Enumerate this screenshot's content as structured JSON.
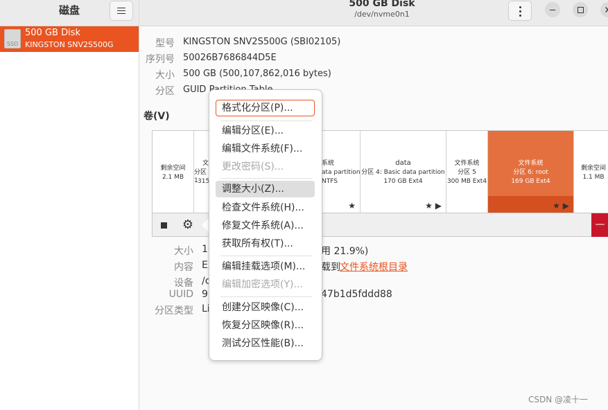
{
  "sidebar": {
    "title": "磁盘",
    "disk": {
      "icon_text": "SSD",
      "name": "500 GB Disk",
      "model": "KINGSTON SNV2S500G"
    }
  },
  "header": {
    "title": "500 GB Disk",
    "subtitle": "/dev/nvme0n1"
  },
  "drive_info": {
    "model_label": "型号",
    "model_value": "KINGSTON SNV2S500G (SBI02105)",
    "serial_label": "序列号",
    "serial_value": "50026B7686844D5E",
    "size_label": "大小",
    "size_value": "500 GB (500,107,862,016 bytes)",
    "partition_label": "分区",
    "partition_value": "GUID Partition Table"
  },
  "volumes": {
    "heading": "卷(V)",
    "segments": [
      {
        "line1": "剩余空间",
        "line2": "2.1 MB",
        "line3": ""
      },
      {
        "line1": "文",
        "line2": "分区 1",
        "line3": "315"
      },
      {
        "line1": "系统",
        "line2": "ata partition",
        "line3": "NTFS"
      },
      {
        "line1": "data",
        "line2": "分区 4:  Basic data partition",
        "line3": "170 GB Ext4"
      },
      {
        "line1": "文件系统",
        "line2": "分区 5",
        "line3": "300 MB Ext4"
      },
      {
        "line1": "文件系统",
        "line2": "分区 6:  root",
        "line3": "169 GB Ext4"
      },
      {
        "line1": "剩余空间",
        "line2": "1.1 MB",
        "line3": ""
      }
    ],
    "star_icon": "★",
    "play_icon": "▶"
  },
  "toolbar": {
    "gear_icon": "⚙",
    "minus_label": "—"
  },
  "details": {
    "size_label": "大小",
    "size_value": "16",
    "size_suffix": "用 21.9%)",
    "contents_label": "内容",
    "contents_value": "Ex",
    "contents_suffix": "载到",
    "contents_link": "文件系统根目录",
    "device_label": "设备",
    "device_value": "/c",
    "uuid_label": "UUID",
    "uuid_value": "97",
    "uuid_suffix": "47b1d5fddd88",
    "ptype_label": "分区类型",
    "ptype_value": "Li"
  },
  "menu": {
    "format": "格式化分区(P)...",
    "edit_partition": "编辑分区(E)...",
    "edit_fs": "编辑文件系统(F)...",
    "change_password": "更改密码(S)...",
    "resize": "调整大小(Z)...",
    "check_fs": "检查文件系统(H)...",
    "repair_fs": "修复文件系统(A)...",
    "take_ownership": "获取所有权(T)...",
    "edit_mount": "编辑挂载选项(M)...",
    "edit_encryption": "编辑加密选项(Y)...",
    "create_image": "创建分区映像(C)...",
    "restore_image": "恢复分区映像(R)...",
    "benchmark": "测试分区性能(B)..."
  },
  "watermark": "CSDN @凌十一"
}
